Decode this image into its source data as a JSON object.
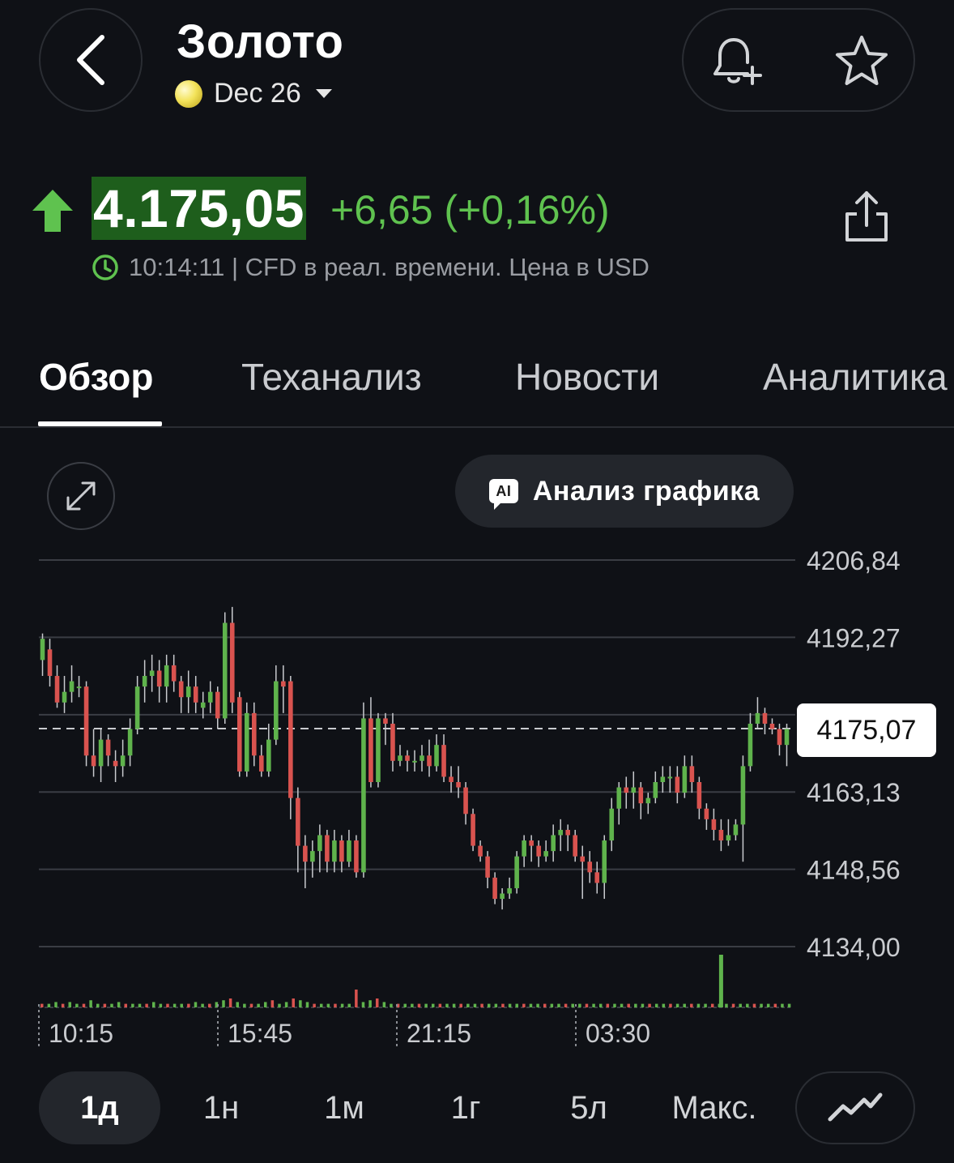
{
  "header": {
    "title": "Золото",
    "contract": "Dec 26",
    "back_icon": "chevron-left-icon",
    "alert_icon": "bell-plus-icon",
    "favorite_icon": "star-icon"
  },
  "quote": {
    "price": "4.175,05",
    "change": "+6,65 (+0,16%)",
    "direction": "up",
    "meta": "10:14:11 | CFD в реал. времени. Цена в USD",
    "colors": {
      "up": "#5fc24f",
      "price_highlight": "#1e5e1c",
      "down": "#e0605a"
    }
  },
  "tabs": [
    {
      "label": "Обзор",
      "active": true
    },
    {
      "label": "Теханализ",
      "active": false
    },
    {
      "label": "Новости",
      "active": false
    },
    {
      "label": "Аналитика",
      "active": false
    }
  ],
  "chart_controls": {
    "ai_badge": "AI",
    "ai_button": "Анализ графика"
  },
  "chart_data": {
    "type": "candlestick",
    "y_ticks": [
      "4206,84",
      "4192,27",
      "4163,13",
      "4148,56",
      "4134,00"
    ],
    "ylim": [
      4134.0,
      4206.84
    ],
    "x_ticks": [
      "10:15",
      "15:45",
      "21:15",
      "03:30"
    ],
    "current_price_label": "4175,07",
    "current_price": 4175.07,
    "candles": [
      [
        4188,
        4192,
        4185,
        4193
      ],
      [
        4190,
        4185,
        4183,
        4192
      ],
      [
        4185,
        4180,
        4179,
        4187
      ],
      [
        4180,
        4182,
        4178,
        4185
      ],
      [
        4182,
        4184,
        4180,
        4187
      ],
      [
        4183,
        4183,
        4181,
        4185
      ],
      [
        4183,
        4170,
        4168,
        4184
      ],
      [
        4170,
        4168,
        4166,
        4175
      ],
      [
        4168,
        4173,
        4165,
        4175
      ],
      [
        4173,
        4170,
        4168,
        4174
      ],
      [
        4169,
        4168,
        4165,
        4171
      ],
      [
        4168,
        4170,
        4166,
        4173
      ],
      [
        4170,
        4175,
        4168,
        4177
      ],
      [
        4175,
        4183,
        4174,
        4185
      ],
      [
        4183,
        4185,
        4180,
        4188
      ],
      [
        4185,
        4186,
        4182,
        4189
      ],
      [
        4186,
        4183,
        4180,
        4188
      ],
      [
        4183,
        4187,
        4180,
        4189
      ],
      [
        4187,
        4184,
        4182,
        4189
      ],
      [
        4184,
        4181,
        4178,
        4185
      ],
      [
        4181,
        4183,
        4178,
        4186
      ],
      [
        4183,
        4180,
        4178,
        4185
      ],
      [
        4179,
        4180,
        4177,
        4182
      ],
      [
        4180,
        4182,
        4178,
        4184
      ],
      [
        4182,
        4177,
        4175,
        4183
      ],
      [
        4177,
        4195,
        4176,
        4197
      ],
      [
        4195,
        4180,
        4178,
        4198
      ],
      [
        4181,
        4167,
        4166,
        4182
      ],
      [
        4167,
        4178,
        4166,
        4180
      ],
      [
        4178,
        4170,
        4168,
        4180
      ],
      [
        4170,
        4167,
        4166,
        4172
      ],
      [
        4167,
        4173,
        4166,
        4176
      ],
      [
        4173,
        4184,
        4172,
        4187
      ],
      [
        4184,
        4183,
        4178,
        4187
      ],
      [
        4184,
        4162,
        4158,
        4185
      ],
      [
        4162,
        4153,
        4148,
        4164
      ],
      [
        4153,
        4150,
        4145,
        4155
      ],
      [
        4150,
        4152,
        4147,
        4154
      ],
      [
        4152,
        4155,
        4148,
        4157
      ],
      [
        4155,
        4150,
        4148,
        4156
      ],
      [
        4150,
        4154,
        4148,
        4156
      ],
      [
        4154,
        4150,
        4148,
        4155
      ],
      [
        4150,
        4154,
        4149,
        4156
      ],
      [
        4154,
        4148,
        4147,
        4155
      ],
      [
        4148,
        4177,
        4147,
        4180
      ],
      [
        4177,
        4165,
        4164,
        4181
      ],
      [
        4165,
        4177,
        4164,
        4178
      ],
      [
        4177,
        4176,
        4172,
        4178
      ],
      [
        4176,
        4169,
        4167,
        4178
      ],
      [
        4169,
        4170,
        4168,
        4172
      ],
      [
        4170,
        4169,
        4167,
        4171
      ],
      [
        4169,
        4169,
        4167,
        4171
      ],
      [
        4169,
        4170,
        4167,
        4172
      ],
      [
        4170,
        4168,
        4166,
        4173
      ],
      [
        4168,
        4172,
        4167,
        4174
      ],
      [
        4172,
        4166,
        4165,
        4174
      ],
      [
        4166,
        4165,
        4163,
        4168
      ],
      [
        4165,
        4164,
        4162,
        4168
      ],
      [
        4164,
        4159,
        4157,
        4165
      ],
      [
        4159,
        4153,
        4152,
        4160
      ],
      [
        4153,
        4151,
        4150,
        4154
      ],
      [
        4151,
        4147,
        4145,
        4152
      ],
      [
        4147,
        4143,
        4142,
        4148
      ],
      [
        4143,
        4144,
        4141,
        4145
      ],
      [
        4144,
        4145,
        4143,
        4147
      ],
      [
        4145,
        4151,
        4144,
        4152
      ],
      [
        4151,
        4154,
        4149,
        4155
      ],
      [
        4154,
        4153,
        4150,
        4155
      ],
      [
        4153,
        4151,
        4149,
        4154
      ],
      [
        4151,
        4152,
        4150,
        4154
      ],
      [
        4152,
        4155,
        4150,
        4157
      ],
      [
        4155,
        4156,
        4152,
        4158
      ],
      [
        4156,
        4155,
        4152,
        4157
      ],
      [
        4155,
        4151,
        4150,
        4156
      ],
      [
        4151,
        4150,
        4143,
        4153
      ],
      [
        4150,
        4148,
        4146,
        4152
      ],
      [
        4148,
        4146,
        4144,
        4150
      ],
      [
        4146,
        4154,
        4143,
        4155
      ],
      [
        4154,
        4160,
        4152,
        4162
      ],
      [
        4160,
        4164,
        4157,
        4165
      ],
      [
        4164,
        4163,
        4160,
        4166
      ],
      [
        4163,
        4164,
        4160,
        4167
      ],
      [
        4164,
        4161,
        4158,
        4165
      ],
      [
        4161,
        4162,
        4159,
        4163
      ],
      [
        4162,
        4165,
        4161,
        4167
      ],
      [
        4165,
        4166,
        4163,
        4168
      ],
      [
        4166,
        4166,
        4163,
        4168
      ],
      [
        4166,
        4163,
        4161,
        4168
      ],
      [
        4163,
        4168,
        4162,
        4170
      ],
      [
        4168,
        4165,
        4163,
        4170
      ],
      [
        4165,
        4160,
        4158,
        4166
      ],
      [
        4160,
        4158,
        4156,
        4161
      ],
      [
        4158,
        4156,
        4154,
        4160
      ],
      [
        4156,
        4154,
        4152,
        4158
      ],
      [
        4154,
        4155,
        4153,
        4158
      ],
      [
        4155,
        4157,
        4154,
        4158
      ],
      [
        4157,
        4168,
        4150,
        4170
      ],
      [
        4168,
        4176,
        4167,
        4178
      ],
      [
        4176,
        4178,
        4175,
        4181
      ],
      [
        4178,
        4176,
        4174,
        4179
      ],
      [
        4176,
        4175,
        4174,
        4177
      ],
      [
        4175,
        4172,
        4170,
        4176
      ],
      [
        4172,
        4175,
        4168,
        4176
      ]
    ],
    "volumes": [
      2,
      2,
      3,
      2,
      3,
      2,
      2,
      4,
      2,
      2,
      2,
      3,
      2,
      2,
      2,
      2,
      3,
      2,
      2,
      2,
      2,
      2,
      3,
      2,
      2,
      3,
      4,
      5,
      3,
      2,
      2,
      2,
      3,
      4,
      2,
      3,
      5,
      4,
      3,
      2,
      2,
      2,
      2,
      2,
      2,
      10,
      3,
      4,
      5,
      3,
      2,
      2,
      2,
      2,
      2,
      2,
      2,
      2,
      2,
      2,
      2,
      2,
      2,
      2,
      2,
      2,
      2,
      2,
      2,
      2,
      2,
      2,
      2,
      2,
      2,
      2,
      2,
      2,
      2,
      2,
      2,
      2,
      2,
      2,
      2,
      2,
      2,
      2,
      2,
      2,
      2,
      2,
      2,
      2,
      2,
      2,
      2,
      2,
      2,
      2,
      2,
      2,
      2,
      2,
      2,
      2,
      2,
      2,
      2,
      2,
      2,
      2,
      2,
      2,
      2,
      2,
      2,
      2,
      2,
      2,
      2,
      2,
      2,
      2,
      2,
      2,
      2,
      2,
      2,
      2,
      2,
      2,
      2,
      2,
      2,
      2,
      2,
      2,
      2,
      2,
      2,
      2,
      2,
      2,
      2,
      2,
      2,
      2,
      2,
      2,
      2,
      2,
      2,
      2,
      2,
      2,
      2,
      2,
      2,
      2,
      2,
      2,
      2,
      2,
      2,
      2,
      2,
      2,
      2,
      2,
      2,
      2,
      2,
      2,
      2,
      2,
      2,
      2,
      2,
      2,
      2,
      2,
      2,
      2,
      2,
      2,
      2,
      2,
      2,
      2,
      2,
      2,
      2,
      2,
      2,
      2,
      2,
      2,
      2,
      2,
      2,
      2,
      2,
      2,
      2,
      2,
      2,
      2,
      2,
      2,
      2,
      2,
      2,
      2,
      2,
      2,
      2,
      2,
      2,
      2,
      2,
      2,
      2,
      2,
      2,
      2,
      2,
      2,
      2,
      2,
      2,
      2,
      2,
      2,
      2,
      2,
      2,
      2,
      2,
      2,
      2,
      2,
      2,
      2,
      2,
      2,
      2,
      2,
      2,
      2,
      2,
      2,
      2,
      2,
      2,
      2,
      2,
      2,
      2,
      2,
      2,
      2,
      2,
      2,
      2,
      2,
      2,
      2,
      2,
      2,
      2,
      2,
      2,
      2,
      2,
      2,
      2,
      2,
      2,
      2,
      2,
      2,
      2,
      2,
      2,
      2,
      2,
      2,
      2,
      2,
      2,
      2,
      2,
      2,
      2,
      2,
      2,
      2,
      2,
      2,
      2,
      2,
      2,
      2,
      2,
      2,
      2,
      2,
      2,
      2,
      2,
      2,
      2,
      2,
      2,
      2,
      2,
      2,
      2,
      2,
      2,
      2,
      2,
      2,
      2,
      2,
      2,
      2,
      2,
      2,
      2,
      2,
      2,
      2,
      2,
      2,
      2,
      2,
      2,
      2,
      2,
      2,
      2,
      2,
      2,
      2,
      2,
      2,
      2,
      2,
      2,
      2,
      2,
      2,
      2,
      2,
      2,
      2,
      2,
      2,
      2,
      2,
      2,
      2,
      2,
      2,
      2,
      2,
      2,
      2,
      2,
      2,
      2,
      2,
      2,
      2,
      2,
      2,
      2,
      2,
      2,
      2,
      2,
      2,
      2,
      2,
      2,
      2,
      2,
      2,
      2,
      2,
      2,
      2,
      2,
      2,
      2,
      2,
      2,
      2,
      2,
      2,
      2,
      2,
      2,
      2,
      2,
      2,
      2,
      2,
      2,
      2,
      2,
      2,
      2,
      2,
      2,
      2,
      2,
      2,
      2,
      2,
      2,
      2,
      2,
      2,
      2,
      2,
      2,
      2,
      2,
      2,
      2,
      2,
      2,
      2,
      2,
      2,
      2,
      2,
      2,
      2,
      2,
      2,
      2,
      2,
      2,
      2,
      2,
      2,
      2,
      2,
      2,
      2,
      2,
      2,
      2,
      2,
      2,
      2,
      2,
      2,
      2,
      2,
      2,
      2,
      2,
      2,
      2,
      2,
      2,
      2,
      2,
      2,
      2,
      2,
      2,
      2,
      2,
      2,
      2,
      2,
      2,
      2,
      2,
      2,
      2,
      2,
      2,
      2,
      2,
      2,
      2,
      2,
      2,
      2,
      2,
      2,
      2,
      2,
      2,
      2,
      2,
      2,
      2,
      2,
      2,
      2,
      2,
      2,
      2,
      2,
      2,
      2,
      2,
      2,
      2,
      2,
      2,
      2,
      2,
      2,
      2,
      2,
      2,
      2,
      2,
      2,
      2,
      2,
      2,
      2,
      2,
      2,
      2,
      2,
      2,
      2
    ],
    "volume_spike_index": 93,
    "volume_spike_value": 26,
    "grid": true,
    "colors": {
      "up": "#5fb34c",
      "down": "#d9534f",
      "grid": "#3a3d44"
    }
  },
  "ranges": [
    {
      "label": "1д",
      "active": true
    },
    {
      "label": "1н",
      "active": false
    },
    {
      "label": "1м",
      "active": false
    },
    {
      "label": "1г",
      "active": false
    },
    {
      "label": "5л",
      "active": false
    },
    {
      "label": "Макс.",
      "active": false
    }
  ],
  "chart_type_icon": "line-chart-icon"
}
